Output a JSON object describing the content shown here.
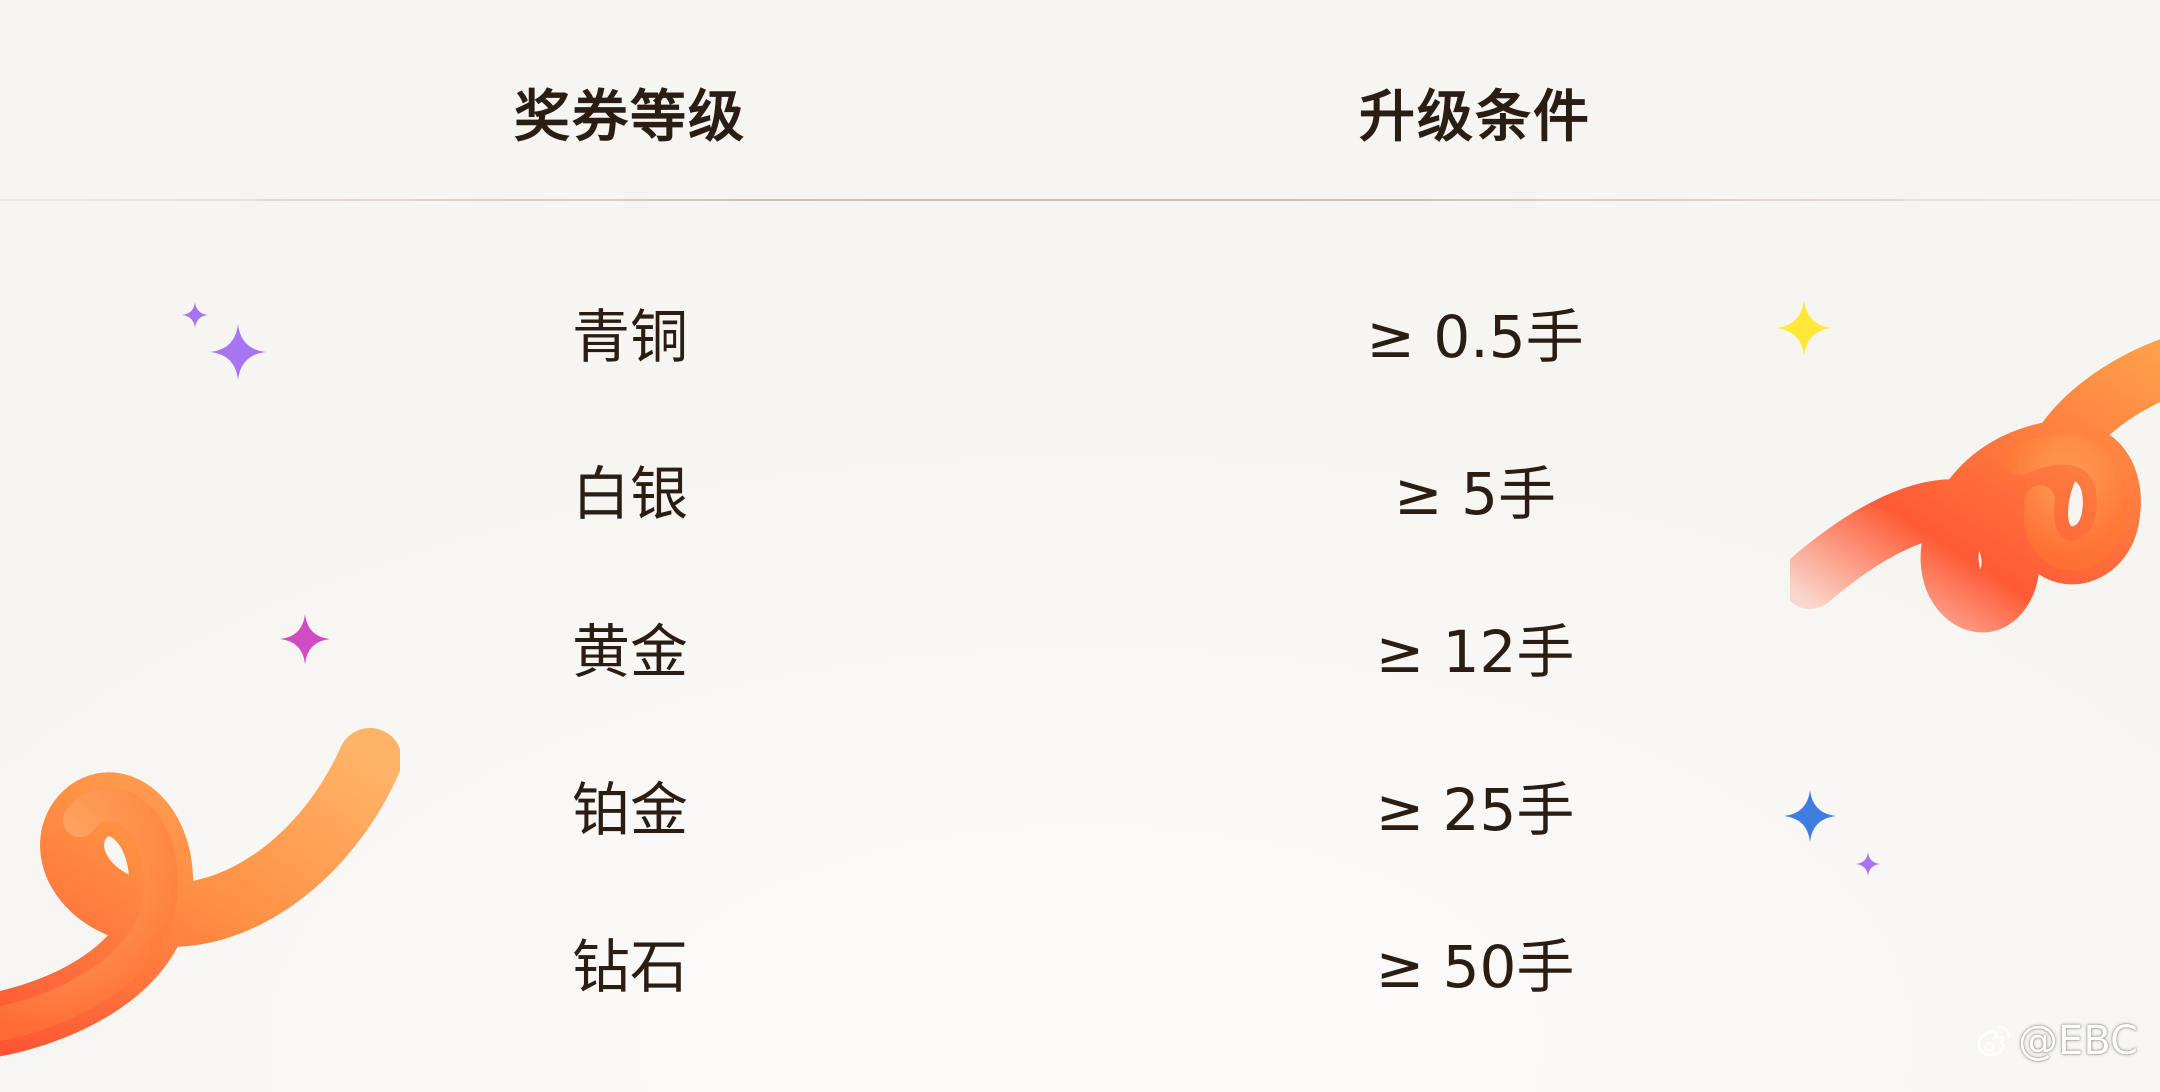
{
  "table": {
    "headers": {
      "level": "奖券等级",
      "condition": "升级条件"
    },
    "rows": [
      {
        "level": "青铜",
        "condition": "≥ 0.5手"
      },
      {
        "level": "白银",
        "condition": "≥ 5手"
      },
      {
        "level": "黄金",
        "condition": "≥ 12手"
      },
      {
        "level": "铂金",
        "condition": "≥ 25手"
      },
      {
        "level": "钻石",
        "condition": "≥ 50手"
      }
    ]
  },
  "watermark": {
    "text": "@EBC",
    "icon": "weibo-logo-icon"
  },
  "colors": {
    "text": "#2a1d14",
    "background": "#f7f5f2",
    "ribbon_orange": "#ff8a3d",
    "sparkle_purple": "#a775f0",
    "sparkle_pink": "#d04cc2",
    "sparkle_yellow": "#ffe83a",
    "sparkle_blue": "#3f7de0"
  },
  "decorations": {
    "left_ribbon": "orange-swirl-ribbon",
    "right_ribbon": "orange-swirl-ribbon",
    "sparkles": [
      "purple-sparkle",
      "pink-sparkle",
      "yellow-sparkle",
      "blue-sparkle"
    ]
  }
}
